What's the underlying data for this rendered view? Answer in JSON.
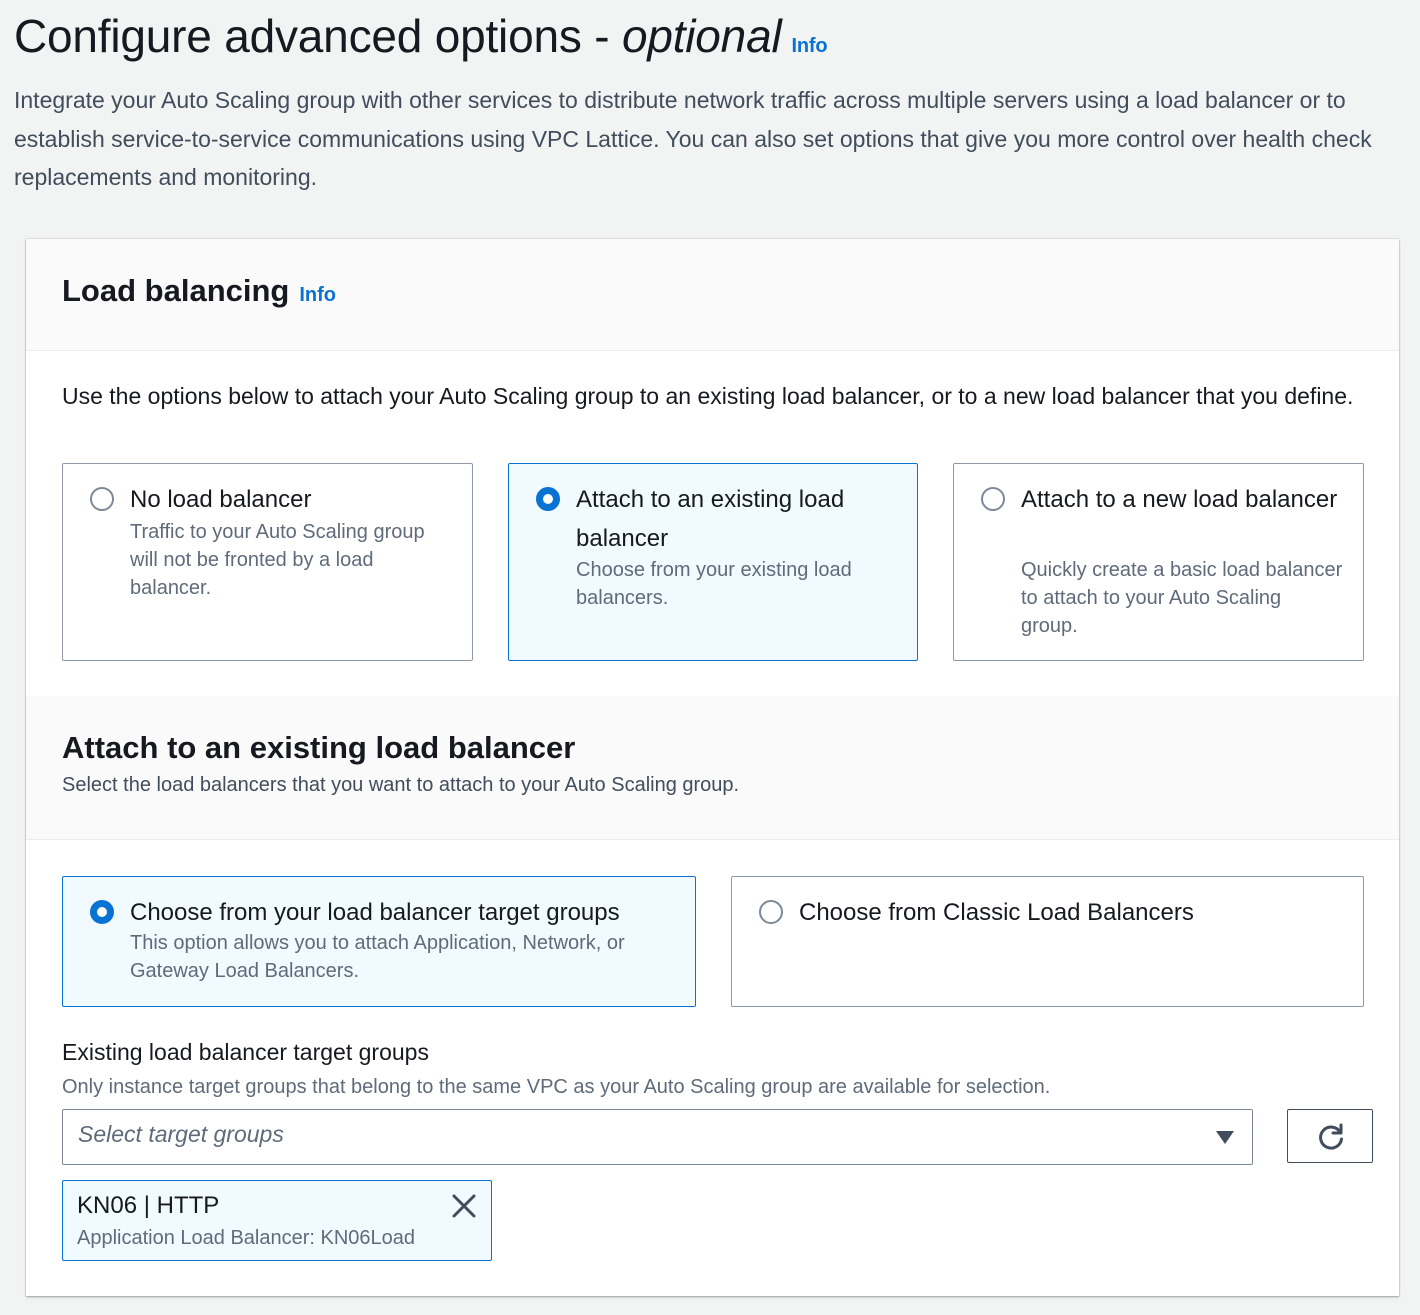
{
  "page": {
    "title": "Configure advanced options - ",
    "title_optional": "optional",
    "info": "Info",
    "description": "Integrate your Auto Scaling group with other services to distribute network traffic across multiple servers using a load balancer or to establish service-to-service communications using VPC Lattice. You can also set options that give you more control over health check replacements and monitoring."
  },
  "load_balancing": {
    "title": "Load balancing",
    "info": "Info",
    "description": "Use the options below to attach your Auto Scaling group to an existing load balancer, or to a new load balancer that you define.",
    "selected": "existing",
    "options": [
      {
        "label": "No load balancer",
        "description": "Traffic to your Auto Scaling group will not be fronted by a load balancer."
      },
      {
        "label": "Attach to an existing load balancer",
        "description": "Choose from your existing load balancers."
      },
      {
        "label": "Attach to a new load balancer",
        "description": "Quickly create a basic load balancer to attach to your Auto Scaling group."
      }
    ]
  },
  "attach_existing": {
    "title": "Attach to an existing load balancer",
    "description": "Select the load balancers that you want to attach to your Auto Scaling group.",
    "selected": "target-groups",
    "options": [
      {
        "label": "Choose from your load balancer target groups",
        "description": "This option allows you to attach Application, Network, or Gateway Load Balancers."
      },
      {
        "label": "Choose from Classic Load Balancers",
        "description": ""
      }
    ]
  },
  "target_groups": {
    "label": "Existing load balancer target groups",
    "description": "Only instance target groups that belong to the same VPC as your Auto Scaling group are available for selection.",
    "placeholder": "Select target groups",
    "tokens": [
      {
        "title": "KN06 | HTTP",
        "subtitle": "Application Load Balancer: KN06Load"
      }
    ]
  },
  "icons": {
    "dropdown": "caret-down-icon",
    "refresh": "refresh-icon",
    "dismiss": "close-icon"
  },
  "colors": {
    "accent": "#0972d3",
    "selected_bg": "#f1faff",
    "page_bg": "#f2f3f3"
  }
}
